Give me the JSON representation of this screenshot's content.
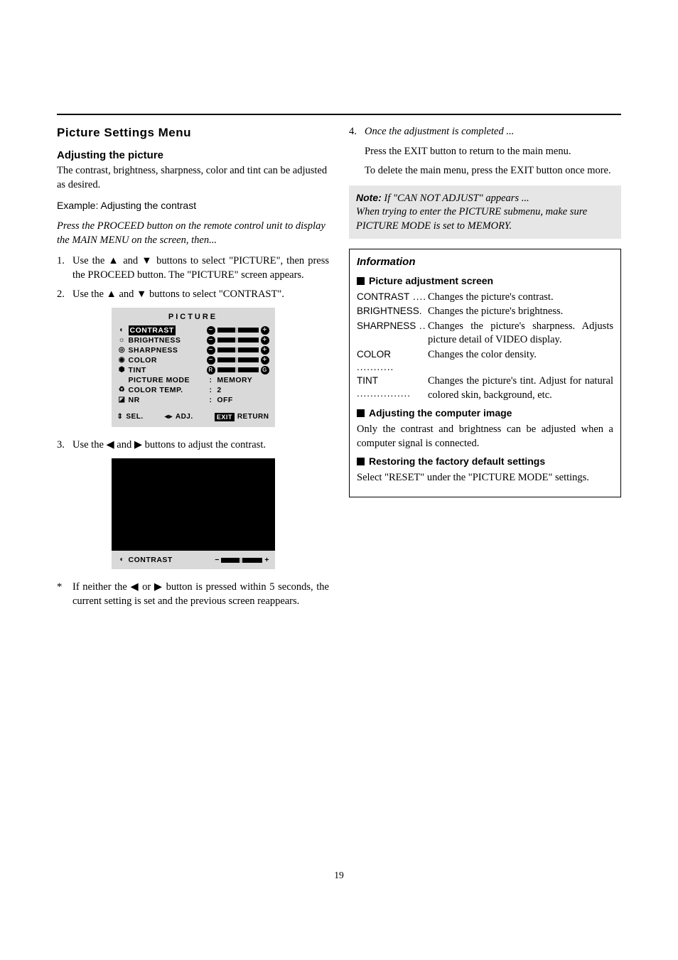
{
  "left": {
    "section_title": "Picture Settings Menu",
    "sub_title": "Adjusting the picture",
    "intro": "The contrast, brightness, sharpness, color and tint can be adjusted as desired.",
    "example_line": "Example: Adjusting the contrast",
    "italic_intro": "Press the PROCEED button on the remote control unit to display the MAIN MENU on the screen, then...",
    "step1_num": "1.",
    "step1": "Use the ▲ and ▼ buttons to select \"PICTURE\", then press the PROCEED button. The \"PICTURE\" screen appears.",
    "step2_num": "2.",
    "step2": "Use the ▲ and ▼ buttons to select \"CONTRAST\".",
    "step3_num": "3.",
    "step3": "Use the ◀  and ▶ buttons to adjust the contrast.",
    "star_num": "*",
    "star": "If neither the ◀ or ▶ button is pressed within 5 seconds, the current setting is set and the previous screen reappears."
  },
  "osd1": {
    "title": "PICTURE",
    "rows": [
      "CONTRAST",
      "BRIGHTNESS",
      "SHARPNESS",
      "COLOR",
      "TINT"
    ],
    "tint_r": "R",
    "tint_g": "G",
    "v1_label": "PICTURE MODE",
    "v1_val": "MEMORY",
    "v2_ic": "♻",
    "v2_label": "COLOR TEMP.",
    "v2_val": "2",
    "v3_ic": "◪",
    "v3_label": "NR",
    "v3_val": "OFF",
    "foot_sel": "SEL.",
    "foot_adj": "ADJ.",
    "foot_exit": "EXIT",
    "foot_return": "RETURN"
  },
  "osd2": {
    "label": "CONTRAST"
  },
  "right": {
    "step4_num": "4.",
    "step4_it": "Once the adjustment is completed ...",
    "step4_a": "Press the EXIT button to return to the main menu.",
    "step4_b": "To delete the main menu, press the EXIT button once more.",
    "note_word": "Note:",
    "note_it1": " If \"CAN NOT ADJUST\" appears ...",
    "note_it2": "When trying to enter the PICTURE submenu, make sure PICTURE MODE is set to MEMORY.",
    "info_title": "Information",
    "sq1": "Picture adjustment screen",
    "d1_term": "CONTRAST",
    "d1_dots": " ....",
    "d1_desc": "Changes the picture's contrast.",
    "d2_term": "BRIGHTNESS",
    "d2_dots": ".",
    "d2_desc": "Changes the picture's brightness.",
    "d3_term": "SHARPNESS",
    "d3_dots": " ..",
    "d3_desc": "Changes the picture's sharpness. Adjusts picture detail of VIDEO display.",
    "d4_term": "COLOR",
    "d4_dots": " ...........",
    "d4_desc": "Changes the color density.",
    "d5_term": "TINT",
    "d5_dots": " ................",
    "d5_desc": "Changes the picture's tint. Adjust for natural colored skin, background, etc.",
    "sq2": "Adjusting the computer image",
    "p2": "Only the contrast and brightness can be adjusted when a computer signal is connected.",
    "sq3": "Restoring the factory default settings",
    "p3": "Select \"RESET\" under the \"PICTURE MODE\" settings."
  },
  "pagenum": "19"
}
